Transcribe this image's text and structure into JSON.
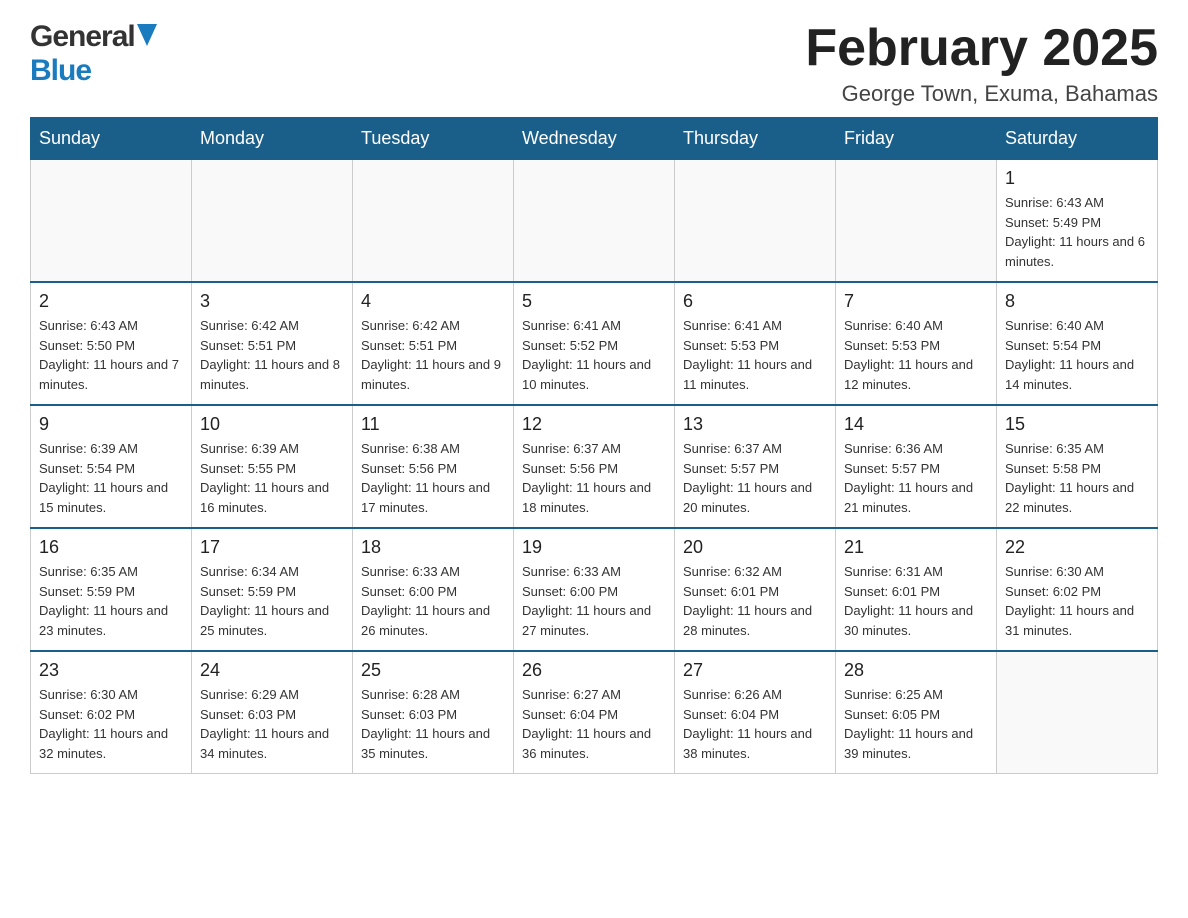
{
  "header": {
    "logo_general": "General",
    "logo_blue": "Blue",
    "month_title": "February 2025",
    "location": "George Town, Exuma, Bahamas"
  },
  "days_of_week": [
    "Sunday",
    "Monday",
    "Tuesday",
    "Wednesday",
    "Thursday",
    "Friday",
    "Saturday"
  ],
  "weeks": [
    {
      "days": [
        {
          "number": "",
          "info": ""
        },
        {
          "number": "",
          "info": ""
        },
        {
          "number": "",
          "info": ""
        },
        {
          "number": "",
          "info": ""
        },
        {
          "number": "",
          "info": ""
        },
        {
          "number": "",
          "info": ""
        },
        {
          "number": "1",
          "info": "Sunrise: 6:43 AM\nSunset: 5:49 PM\nDaylight: 11 hours and 6 minutes."
        }
      ]
    },
    {
      "days": [
        {
          "number": "2",
          "info": "Sunrise: 6:43 AM\nSunset: 5:50 PM\nDaylight: 11 hours and 7 minutes."
        },
        {
          "number": "3",
          "info": "Sunrise: 6:42 AM\nSunset: 5:51 PM\nDaylight: 11 hours and 8 minutes."
        },
        {
          "number": "4",
          "info": "Sunrise: 6:42 AM\nSunset: 5:51 PM\nDaylight: 11 hours and 9 minutes."
        },
        {
          "number": "5",
          "info": "Sunrise: 6:41 AM\nSunset: 5:52 PM\nDaylight: 11 hours and 10 minutes."
        },
        {
          "number": "6",
          "info": "Sunrise: 6:41 AM\nSunset: 5:53 PM\nDaylight: 11 hours and 11 minutes."
        },
        {
          "number": "7",
          "info": "Sunrise: 6:40 AM\nSunset: 5:53 PM\nDaylight: 11 hours and 12 minutes."
        },
        {
          "number": "8",
          "info": "Sunrise: 6:40 AM\nSunset: 5:54 PM\nDaylight: 11 hours and 14 minutes."
        }
      ]
    },
    {
      "days": [
        {
          "number": "9",
          "info": "Sunrise: 6:39 AM\nSunset: 5:54 PM\nDaylight: 11 hours and 15 minutes."
        },
        {
          "number": "10",
          "info": "Sunrise: 6:39 AM\nSunset: 5:55 PM\nDaylight: 11 hours and 16 minutes."
        },
        {
          "number": "11",
          "info": "Sunrise: 6:38 AM\nSunset: 5:56 PM\nDaylight: 11 hours and 17 minutes."
        },
        {
          "number": "12",
          "info": "Sunrise: 6:37 AM\nSunset: 5:56 PM\nDaylight: 11 hours and 18 minutes."
        },
        {
          "number": "13",
          "info": "Sunrise: 6:37 AM\nSunset: 5:57 PM\nDaylight: 11 hours and 20 minutes."
        },
        {
          "number": "14",
          "info": "Sunrise: 6:36 AM\nSunset: 5:57 PM\nDaylight: 11 hours and 21 minutes."
        },
        {
          "number": "15",
          "info": "Sunrise: 6:35 AM\nSunset: 5:58 PM\nDaylight: 11 hours and 22 minutes."
        }
      ]
    },
    {
      "days": [
        {
          "number": "16",
          "info": "Sunrise: 6:35 AM\nSunset: 5:59 PM\nDaylight: 11 hours and 23 minutes."
        },
        {
          "number": "17",
          "info": "Sunrise: 6:34 AM\nSunset: 5:59 PM\nDaylight: 11 hours and 25 minutes."
        },
        {
          "number": "18",
          "info": "Sunrise: 6:33 AM\nSunset: 6:00 PM\nDaylight: 11 hours and 26 minutes."
        },
        {
          "number": "19",
          "info": "Sunrise: 6:33 AM\nSunset: 6:00 PM\nDaylight: 11 hours and 27 minutes."
        },
        {
          "number": "20",
          "info": "Sunrise: 6:32 AM\nSunset: 6:01 PM\nDaylight: 11 hours and 28 minutes."
        },
        {
          "number": "21",
          "info": "Sunrise: 6:31 AM\nSunset: 6:01 PM\nDaylight: 11 hours and 30 minutes."
        },
        {
          "number": "22",
          "info": "Sunrise: 6:30 AM\nSunset: 6:02 PM\nDaylight: 11 hours and 31 minutes."
        }
      ]
    },
    {
      "days": [
        {
          "number": "23",
          "info": "Sunrise: 6:30 AM\nSunset: 6:02 PM\nDaylight: 11 hours and 32 minutes."
        },
        {
          "number": "24",
          "info": "Sunrise: 6:29 AM\nSunset: 6:03 PM\nDaylight: 11 hours and 34 minutes."
        },
        {
          "number": "25",
          "info": "Sunrise: 6:28 AM\nSunset: 6:03 PM\nDaylight: 11 hours and 35 minutes."
        },
        {
          "number": "26",
          "info": "Sunrise: 6:27 AM\nSunset: 6:04 PM\nDaylight: 11 hours and 36 minutes."
        },
        {
          "number": "27",
          "info": "Sunrise: 6:26 AM\nSunset: 6:04 PM\nDaylight: 11 hours and 38 minutes."
        },
        {
          "number": "28",
          "info": "Sunrise: 6:25 AM\nSunset: 6:05 PM\nDaylight: 11 hours and 39 minutes."
        },
        {
          "number": "",
          "info": ""
        }
      ]
    }
  ]
}
